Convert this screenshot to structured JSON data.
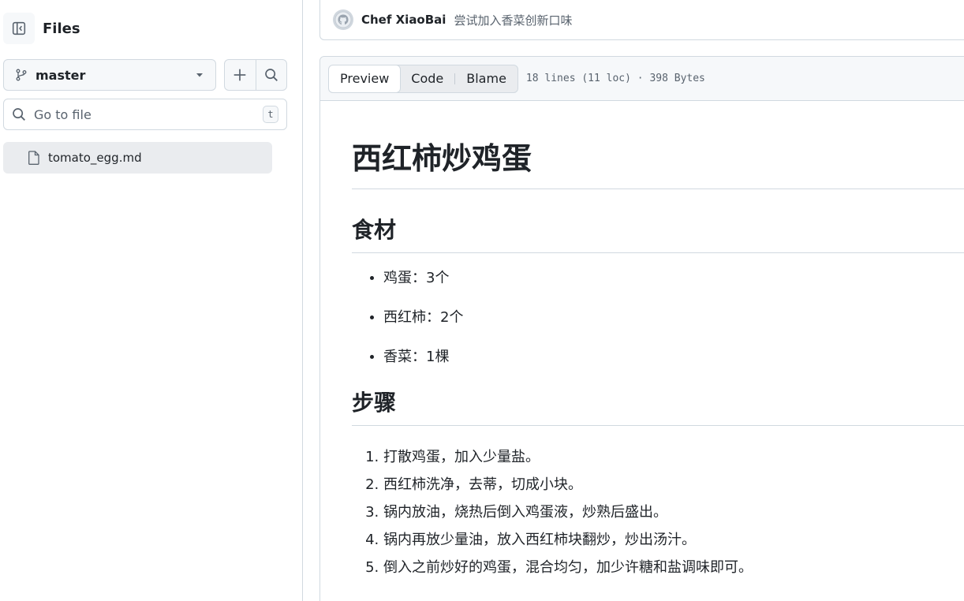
{
  "sidebar": {
    "title": "Files",
    "branch": "master",
    "goto_placeholder": "Go to file",
    "goto_shortcut": "t",
    "files": [
      {
        "name": "tomato_egg.md"
      }
    ]
  },
  "commit": {
    "author": "Chef XiaoBai",
    "message": "尝试加入香菜创新口味"
  },
  "file_header": {
    "tabs": [
      "Preview",
      "Code",
      "Blame"
    ],
    "active_tab": "Preview",
    "meta": "18 lines (11 loc) · 398 Bytes"
  },
  "markdown": {
    "title": "西红柿炒鸡蛋",
    "ingredients_heading": "食材",
    "ingredients": [
      "鸡蛋：3个",
      "西红柿：2个",
      "香菜：1棵"
    ],
    "steps_heading": "步骤",
    "steps": [
      "打散鸡蛋，加入少量盐。",
      "西红柿洗净，去蒂，切成小块。",
      "锅内放油，烧热后倒入鸡蛋液，炒熟后盛出。",
      "锅内再放少量油，放入西红柿块翻炒，炒出汤汁。",
      "倒入之前炒好的鸡蛋，混合均匀，加少许糖和盐调味即可。"
    ]
  }
}
